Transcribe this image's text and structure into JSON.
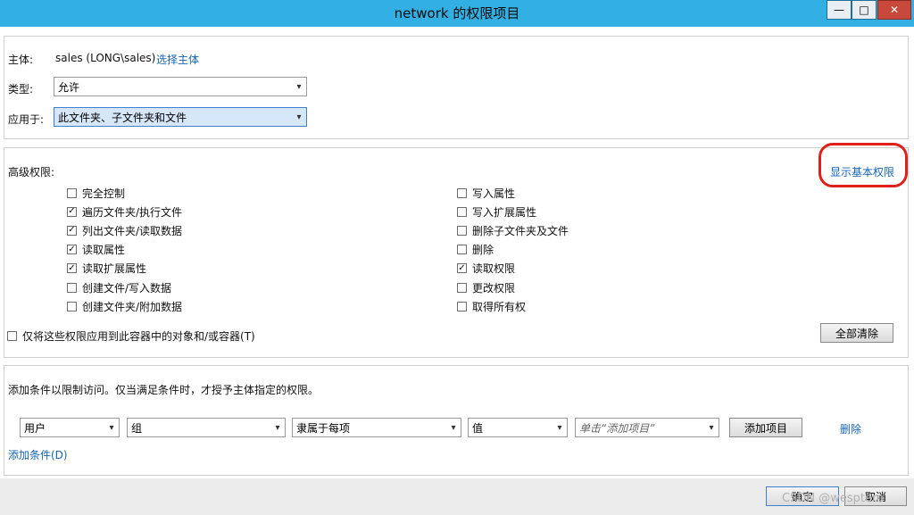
{
  "window": {
    "title": "network 的权限项目",
    "minimize_glyph": "—",
    "maximize_glyph": "□",
    "close_glyph": "✕"
  },
  "principal": {
    "label": "主体:",
    "value": "sales (LONG\\sales)",
    "select_link": "选择主体"
  },
  "type": {
    "label": "类型:",
    "value": "允许"
  },
  "applies_to": {
    "label": "应用于:",
    "value": "此文件夹、子文件夹和文件"
  },
  "advanced": {
    "label": "高级权限:",
    "show_basic_link": "显示基本权限",
    "left": [
      {
        "label": "完全控制",
        "checked": false
      },
      {
        "label": "遍历文件夹/执行文件",
        "checked": true
      },
      {
        "label": "列出文件夹/读取数据",
        "checked": true
      },
      {
        "label": "读取属性",
        "checked": true
      },
      {
        "label": "读取扩展属性",
        "checked": true
      },
      {
        "label": "创建文件/写入数据",
        "checked": false
      },
      {
        "label": "创建文件夹/附加数据",
        "checked": false
      }
    ],
    "right": [
      {
        "label": "写入属性",
        "checked": false
      },
      {
        "label": "写入扩展属性",
        "checked": false
      },
      {
        "label": "删除子文件夹及文件",
        "checked": false
      },
      {
        "label": "删除",
        "checked": false
      },
      {
        "label": "读取权限",
        "checked": true
      },
      {
        "label": "更改权限",
        "checked": false
      },
      {
        "label": "取得所有权",
        "checked": false
      }
    ],
    "apply_only_label": "仅将这些权限应用到此容器中的对象和/或容器(T)",
    "clear_all_button": "全部清除"
  },
  "conditions": {
    "description": "添加条件以限制访问。仅当满足条件时，才授予主体指定的权限。",
    "user_select": "用户",
    "group_select": "组",
    "operator_select": "隶属于每项",
    "value_select": "值",
    "item_placeholder": "单击“添加项目”",
    "add_item_button": "添加项目",
    "delete_link": "删除",
    "add_condition_link": "添加条件(D)"
  },
  "footer": {
    "ok_button": "确定",
    "cancel_button": "取消",
    "watermark": "CSDN @wesptem"
  },
  "colors": {
    "titlebar": "#33b0e3",
    "link": "#1565b5",
    "highlight_circle": "#e0201a"
  }
}
